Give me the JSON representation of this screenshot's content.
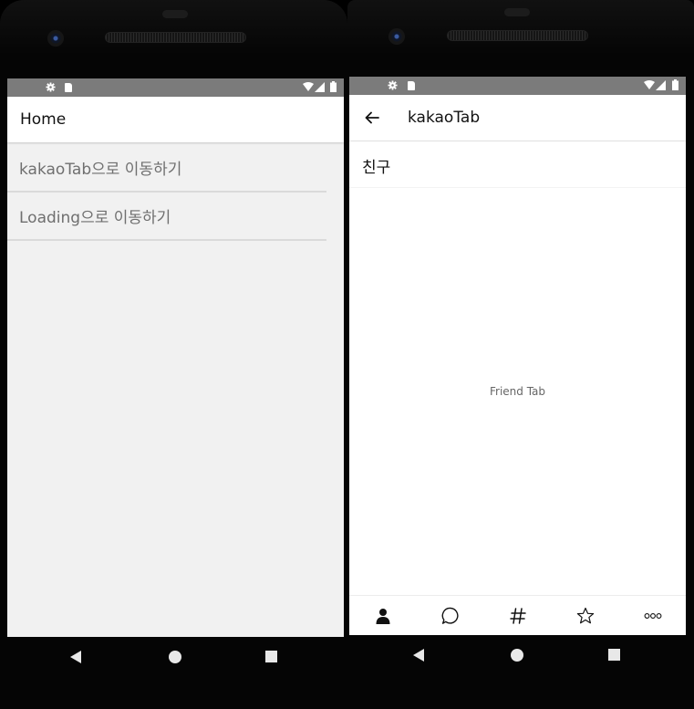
{
  "left_screen": {
    "header": {
      "title": "Home"
    },
    "list": [
      {
        "label": "kakaoTab으로 이동하기"
      },
      {
        "label": "Loading으로 이동하기"
      }
    ]
  },
  "right_screen": {
    "header": {
      "title": "kakaoTab"
    },
    "section_title": "친구",
    "content_text": "Friend Tab",
    "tabs": [
      {
        "icon": "person-icon",
        "active": true
      },
      {
        "icon": "chat-bubble-icon",
        "active": false
      },
      {
        "icon": "hashtag-icon",
        "active": false
      },
      {
        "icon": "star-icon",
        "active": false
      },
      {
        "icon": "more-dots-icon",
        "active": false
      }
    ]
  },
  "colors": {
    "status_bar": "#7b7b7b",
    "left_background": "#f1f1f1",
    "list_text": "#6f6f6f",
    "divider": "#dadada"
  }
}
